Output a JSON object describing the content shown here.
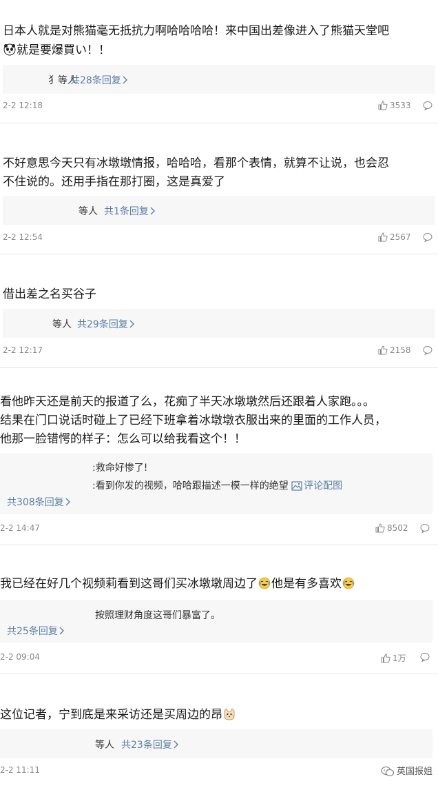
{
  "comments": [
    {
      "text_line1": "日本人就是对熊猫毫无抵抗力啊哈哈哈哈！来中国出差像进入了熊猫天堂吧",
      "text_line2_after_emoji": "就是要爆買い！！",
      "reply_prefix": "犭等人",
      "reply_count": "共28条回复",
      "time": "2-2 12:18",
      "likes": "3533"
    },
    {
      "text_line1": "不好意思今天只有冰墩墩情报，哈哈哈，看那个表情，就算不让说，也会忍",
      "text_line2": "不住说的。还用手指在那打圈，这是真爱了",
      "reply_prefix": "等人",
      "reply_count": "共1条回复",
      "time": "2-2 12:54",
      "likes": "2567"
    },
    {
      "text_line1": "借出差之名买谷子",
      "reply_prefix": "等人",
      "reply_count": "共29条回复",
      "time": "2-2 12:17",
      "likes": "2158"
    },
    {
      "text_line1": "看他昨天还是前天的报道了么，花痴了半天冰墩墩然后还跟着人家跑。。。",
      "text_line2": "结果在门口说话时碰上了已经下班拿着冰墩墩衣服出来的里面的工作人员，",
      "text_line3": "他那一脸错愕的样子：怎么可以给我看这个！！",
      "reply_line1": ":救命好惨了!",
      "reply_line2": ":看到你发的视频，哈哈跟描述一模一样的绝望",
      "reply_image_label": "评论配图",
      "reply_count": "共308条回复",
      "time": "2-2 14:47",
      "likes": "8502"
    },
    {
      "text_line1": "我已经在好几个视频莉看到这哥们买冰墩墩周边了",
      "text_line1_mid": "他是有多喜欢",
      "reply_line1": "按照理财角度这哥们暴富了。",
      "reply_count": "共25条回复",
      "time": "2-2 09:04",
      "likes": "1万"
    },
    {
      "text_line1": "这位记者，宁到底是来采访还是买周边的昂",
      "reply_prefix": "等人",
      "reply_count": "共23条回复",
      "time": "2-2 11:11"
    }
  ],
  "watermark": "英国报姐",
  "icons": {
    "like": "thumbs-up-icon",
    "reply": "comment-bubble-icon",
    "emoji_panda": "panda-emoji-icon",
    "emoji_laugh": "laughing-crying-emoji-icon",
    "emoji_cat": "cat-emoji-icon",
    "image": "image-icon",
    "chevron": "chevron-right-icon"
  },
  "colors": {
    "link_blue": "#5b7ea8",
    "reply_bg": "#f7f7f7",
    "meta_gray": "#888888",
    "divider": "#e5e5e5"
  }
}
